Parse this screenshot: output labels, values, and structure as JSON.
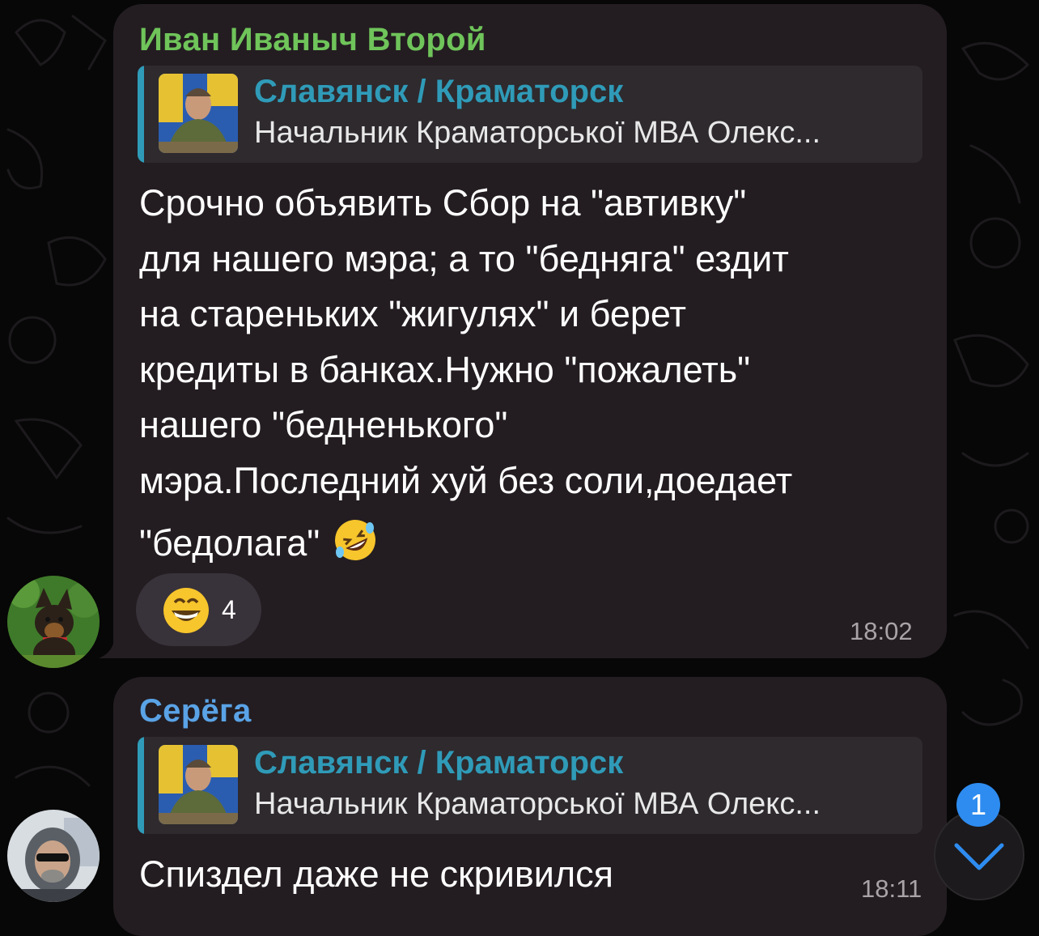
{
  "messages": [
    {
      "sender": "Иван Иваныч Второй",
      "sender_color": "#6fc45a",
      "reply": {
        "title": "Славянск / Краматорск",
        "text": "Начальник Краматорської МВА Олекс..."
      },
      "text_lines": [
        "Срочно объявить Сбор на \"автивку\"",
        "для нашего мэра; а то \"бедняга\" ездит",
        "на стареньких \"жигулях\" и берет",
        "кредиты в банках.Нужно \"пожалеть\"",
        "нашего \"бедненького\"",
        "мэра.Последний хуй без соли,доедает",
        "\"бедолага\""
      ],
      "trailing_emoji": "rolling-on-floor-laughing",
      "reaction": {
        "emoji": "grinning-face",
        "count": "4"
      },
      "time": "18:02"
    },
    {
      "sender": "Серёга",
      "sender_color": "#5aa3e6",
      "reply": {
        "title": "Славянск / Краматорск",
        "text": "Начальник Краматорської МВА Олекс..."
      },
      "text_lines": [
        "Спиздел даже не скривился"
      ],
      "time": "18:11"
    }
  ],
  "scroll_button": {
    "unread_count": "1",
    "icon": "chevron-down-icon"
  }
}
